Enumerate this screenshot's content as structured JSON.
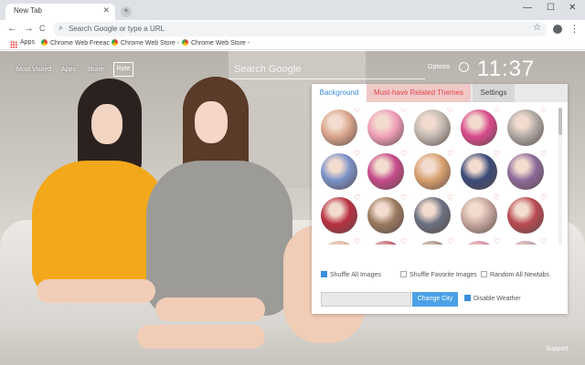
{
  "browser": {
    "tab_title": "New Tab",
    "tab_close": "✕",
    "new_tab": "+",
    "window_controls": [
      "—",
      "☐",
      "✕"
    ],
    "nav": {
      "back": "←",
      "forward": "→",
      "reload": "C"
    },
    "omnibox_placeholder": "Search Google or type a URL",
    "search_icon": "⌕",
    "star_icon": "☆",
    "menu_icon": "⋮",
    "bookmarks": [
      "Apps",
      "Chrome Web Freeac",
      "Chrome Web Store -",
      "Chrome Web Store -"
    ]
  },
  "ntp": {
    "nav_links": [
      "Most Visited",
      "Apps",
      "Share"
    ],
    "rate_label": "Rate",
    "search_placeholder": "Search Google",
    "options_label": "Options",
    "clock": "11:37",
    "support_label": "Support"
  },
  "options_panel": {
    "tabs": [
      "Background",
      "Must-have Related Themes",
      "Settings"
    ],
    "active_tab": "Background",
    "thumbnail_colors": [
      "#d9a58c",
      "#f0a0b8",
      "#c2b8b0",
      "#d84a8c",
      "#b0a8a4",
      "#7a92c8",
      "#c64a8a",
      "#d8a070",
      "#3a4a78",
      "#8c6a9a",
      "#b83040",
      "#9a7a60",
      "#6a7080",
      "#c8a8a0",
      "#b84a52",
      "#e0b8a0",
      "#c06070",
      "#a89088",
      "#d890a8",
      "#c0a0a8"
    ],
    "heart_icon": "♡",
    "checkboxes": [
      {
        "label": "Shuffle All Images",
        "checked": true
      },
      {
        "label": "Shuffle Favorite Images",
        "checked": false
      },
      {
        "label": "Random All Newtabs",
        "checked": false
      }
    ],
    "city_value": "",
    "change_city_label": "Change City",
    "disable_weather_label": "Disable Weather",
    "disable_weather_checked": true
  }
}
